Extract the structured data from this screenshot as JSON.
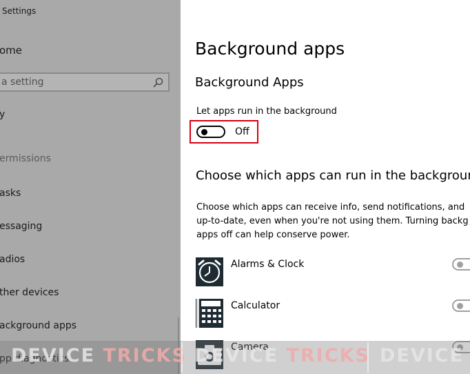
{
  "sidebar": {
    "app_title": "Settings",
    "home_label": "ome",
    "search_placeholder": "a setting",
    "top_item": "y",
    "section_header": "ermissions",
    "items": [
      {
        "label": "asks"
      },
      {
        "label": "essaging"
      },
      {
        "label": "adios"
      },
      {
        "label": "ther devices"
      },
      {
        "label": "ackground apps"
      },
      {
        "label": "pp diagnostics"
      }
    ]
  },
  "main": {
    "page_title": "Background apps",
    "subsection_title": "Background Apps",
    "toggle_label": "Let apps run in the background",
    "toggle_state": "Off",
    "toggle_on": false,
    "choose_title": "Choose which apps can run in the background",
    "choose_desc_lines": [
      "Choose which apps can receive info, send notifications, and",
      "up-to-date, even when you're not using them. Turning backg",
      "apps off can help conserve power."
    ],
    "apps": [
      {
        "name": "Alarms & Clock",
        "icon": "alarm-clock-icon",
        "enabled": false
      },
      {
        "name": "Calculator",
        "icon": "calculator-icon",
        "enabled": false
      },
      {
        "name": "Camera",
        "icon": "camera-icon",
        "enabled": false
      }
    ]
  },
  "watermark": {
    "segments": [
      {
        "part1": "DEVICE",
        "part2": "TRICKS"
      },
      {
        "part1": "DEVICE",
        "part2": "TRICKS"
      },
      {
        "part1": "DEVICE",
        "part2": ""
      }
    ]
  },
  "colors": {
    "sidebar_bg": "#a9a9a9",
    "highlight": "#d3000f",
    "icon_tile": "#1f2b33"
  }
}
